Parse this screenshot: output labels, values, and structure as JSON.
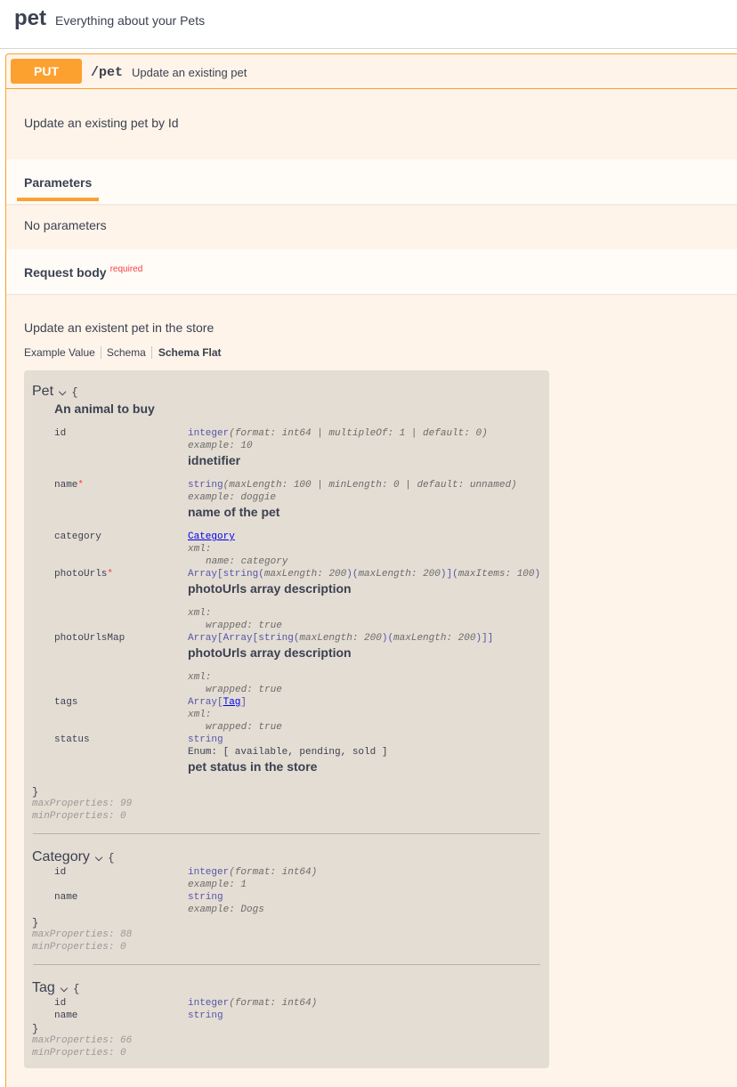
{
  "tag": {
    "name": "pet",
    "description": "Everything about your Pets"
  },
  "operation": {
    "method": "PUT",
    "path": "/pet",
    "summary": "Update an existing pet",
    "description": "Update an existing pet by Id"
  },
  "parameters": {
    "title": "Parameters",
    "empty_text": "No parameters"
  },
  "request_body": {
    "title": "Request body",
    "required_label": "required",
    "description": "Update an existent pet in the store",
    "tabs": [
      "Example Value",
      "Schema",
      "Schema Flat"
    ],
    "active_tab": "Schema Flat"
  },
  "schema": {
    "pet": {
      "name": "Pet",
      "brace_open": "{",
      "brace_close": "}",
      "description": "An animal to buy",
      "props": {
        "id": {
          "name": "id",
          "type": "integer",
          "type_extra": "(format: int64 | multipleOf: 1 | default: 0)",
          "example": "example: 10",
          "desc": "idnetifier"
        },
        "name": {
          "name": "name",
          "required": "*",
          "type": "string",
          "type_extra": "(maxLength: 100 | minLength: 0 | default: unnamed)",
          "example": "example: doggie",
          "desc": "name of the pet"
        },
        "category": {
          "name": "category",
          "link": "Category",
          "xml": "xml:",
          "xml_detail": "name: category"
        },
        "photoUrls": {
          "name": "photoUrls",
          "required": "*",
          "type_pre": "Array[string(",
          "type_mid1": "maxLength: 200",
          "type_mid2": ")(",
          "type_mid3": "maxLength: 200",
          "type_mid4": ")](",
          "type_mid5": "maxItems: 100",
          "type_post": ")",
          "desc": "photoUrls array description",
          "xml": "xml:",
          "xml_detail": "wrapped: true"
        },
        "photoUrlsMap": {
          "name": "photoUrlsMap",
          "type_pre": "Array[Array[string(",
          "type_mid1": "maxLength: 200",
          "type_mid2": ")(",
          "type_mid3": "maxLength: 200",
          "type_post": ")]]",
          "desc": "photoUrls array description",
          "xml": "xml:",
          "xml_detail": "wrapped: true"
        },
        "tags": {
          "name": "tags",
          "type_pre": "Array[",
          "link": "Tag",
          "type_post": "]",
          "xml": "xml:",
          "xml_detail": "wrapped: true"
        },
        "status": {
          "name": "status",
          "type": "string",
          "enum": "Enum: [ available, pending, sold ]",
          "desc": "pet status in the store"
        }
      },
      "max_properties": "maxProperties: 99",
      "min_properties": "minProperties: 0"
    },
    "category": {
      "name": "Category",
      "brace_open": "{",
      "brace_close": "}",
      "props": {
        "id": {
          "name": "id",
          "type": "integer",
          "type_extra": "(format: int64)",
          "example": "example: 1"
        },
        "name": {
          "name": "name",
          "type": "string",
          "example": "example: Dogs"
        }
      },
      "max_properties": "maxProperties: 88",
      "min_properties": "minProperties: 0"
    },
    "tag": {
      "name": "Tag",
      "brace_open": "{",
      "brace_close": "}",
      "props": {
        "id": {
          "name": "id",
          "type": "integer",
          "type_extra": "(format: int64)"
        },
        "name": {
          "name": "name",
          "type": "string"
        }
      },
      "max_properties": "maxProperties: 66",
      "min_properties": "minProperties: 0"
    }
  },
  "colors": {
    "put_accent": "#fca130",
    "opblock_bg": "#fef4ea",
    "model_bg": "#e4ddd3",
    "required": "#f93e3e",
    "type": "#55a"
  },
  "icons": {
    "chevron": "chevron-down-icon"
  }
}
